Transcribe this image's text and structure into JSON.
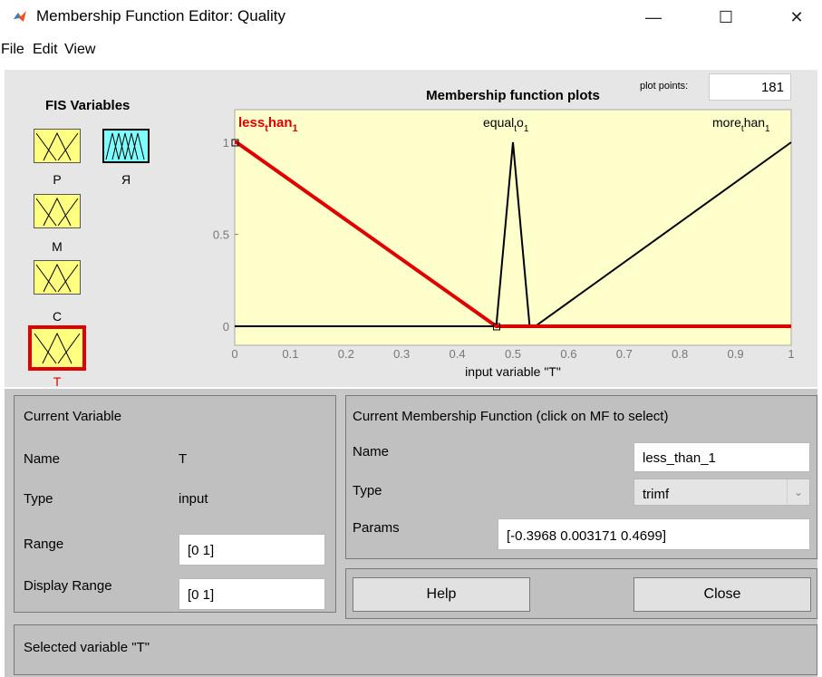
{
  "window": {
    "title": "Membership Function Editor: Quality",
    "minimize": "—",
    "maximize": "☐",
    "close": "✕",
    "icon": "matlab-icon"
  },
  "menu": [
    "File",
    "Edit",
    "View"
  ],
  "fis": {
    "title": "FIS Variables",
    "variables": [
      {
        "name": "P",
        "kind": "input",
        "selected": false
      },
      {
        "name": "Я",
        "kind": "output",
        "selected": false
      },
      {
        "name": "M",
        "kind": "input",
        "selected": false
      },
      {
        "name": "C",
        "kind": "input",
        "selected": false
      },
      {
        "name": "T",
        "kind": "input",
        "selected": true
      }
    ]
  },
  "plot": {
    "title": "Membership function plots",
    "plot_points_label": "plot points:",
    "plot_points": "181",
    "xlabel": "input variable \"T\"",
    "x_ticks": [
      "0",
      "0.1",
      "0.2",
      "0.3",
      "0.4",
      "0.5",
      "0.6",
      "0.7",
      "0.8",
      "0.9",
      "1"
    ],
    "y_ticks": [
      "0",
      "0.5",
      "1"
    ],
    "mf_labels": {
      "less": {
        "base": "less",
        "sub": "t",
        "mid": "han",
        "end": "1"
      },
      "equal": {
        "base": "equal",
        "sub": "t",
        "mid": "o",
        "end": "1"
      },
      "more": {
        "base": "more",
        "sub": "t",
        "mid": "han",
        "end": "1"
      }
    }
  },
  "chart_data": {
    "type": "line",
    "title": "Membership function plots",
    "xlabel": "input variable \"T\"",
    "ylabel": "",
    "xlim": [
      0,
      1
    ],
    "ylim": [
      0,
      1
    ],
    "series": [
      {
        "name": "less_than_1",
        "x": [
          0,
          0.003171,
          0.4699,
          1
        ],
        "y": [
          1,
          1,
          0,
          0
        ],
        "color": "#e00000",
        "selected": true
      },
      {
        "name": "equal_to_1",
        "x": [
          0,
          0.47,
          0.5,
          0.53,
          1
        ],
        "y": [
          0,
          0,
          1,
          0,
          0
        ],
        "color": "#000000",
        "selected": false
      },
      {
        "name": "more_than_1",
        "x": [
          0,
          0.54,
          1
        ],
        "y": [
          0,
          0,
          1
        ],
        "color": "#000000",
        "selected": false
      }
    ]
  },
  "current_variable": {
    "title": "Current Variable",
    "name_label": "Name",
    "name_value": "T",
    "type_label": "Type",
    "type_value": "input",
    "range_label": "Range",
    "range_value": "[0 1]",
    "display_range_label": "Display Range",
    "display_range_value": "[0 1]"
  },
  "current_mf": {
    "title": "Current Membership Function (click on MF to select)",
    "name_label": "Name",
    "name_value": "less_than_1",
    "type_label": "Type",
    "type_value": "trimf",
    "params_label": "Params",
    "params_value": "[-0.3968 0.003171 0.4699]"
  },
  "buttons": {
    "help": "Help",
    "close": "Close"
  },
  "status": "Selected variable \"T\"",
  "colors": {
    "plot_bg": "#ffffcc",
    "selected": "#e00000",
    "mf_icon": "#ffff80",
    "output_icon": "#80ffff"
  }
}
